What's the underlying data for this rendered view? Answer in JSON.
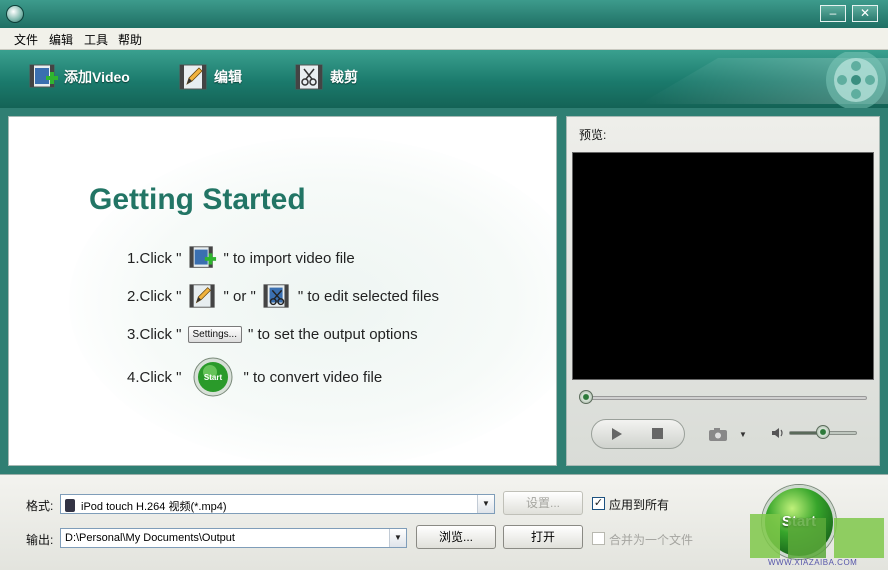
{
  "colors": {
    "toolbar_top": "#3aa08f",
    "toolbar_bottom": "#146356",
    "title_green": "#227565",
    "start_green": "#37a52b"
  },
  "window": {
    "icon": "hd-video-icon",
    "minimize_label": "–",
    "close_label": "✕"
  },
  "menu": {
    "file": "文件",
    "edit": "编辑",
    "tools": "工具",
    "help": "帮助"
  },
  "toolbar": {
    "add_video": "添加Video",
    "edit": "编辑",
    "crop": "裁剪"
  },
  "main": {
    "title": "Getting Started",
    "step1_prefix": "1.Click \"",
    "step1_suffix": "\" to import video file",
    "step2_prefix": "2.Click \"",
    "step2_mid": "\" or \"",
    "step2_suffix": "\" to edit selected files",
    "step3_prefix": "3.Click \"",
    "step3_button": "Settings...",
    "step3_suffix": "\" to set the output options",
    "step4_prefix": "4.Click \"",
    "step4_suffix": "\" to convert video file",
    "start_mini_label": "Start"
  },
  "preview": {
    "label": "预览:",
    "progress": 0.0,
    "volume": 0.5
  },
  "bottom": {
    "format_label": "格式:",
    "format_value": "iPod touch H.264 视频(*.mp4)",
    "output_label": "输出:",
    "output_value": "D:\\Personal\\My Documents\\Output",
    "settings_button": "设置...",
    "browse_button": "浏览...",
    "open_button": "打开",
    "apply_all_label": "应用到所有",
    "apply_all_checked": true,
    "merge_label": "合并为一个文件",
    "merge_checked": false,
    "start_button": "Start"
  },
  "watermark": {
    "text": "WWW.XIAZAIBA.COM"
  }
}
